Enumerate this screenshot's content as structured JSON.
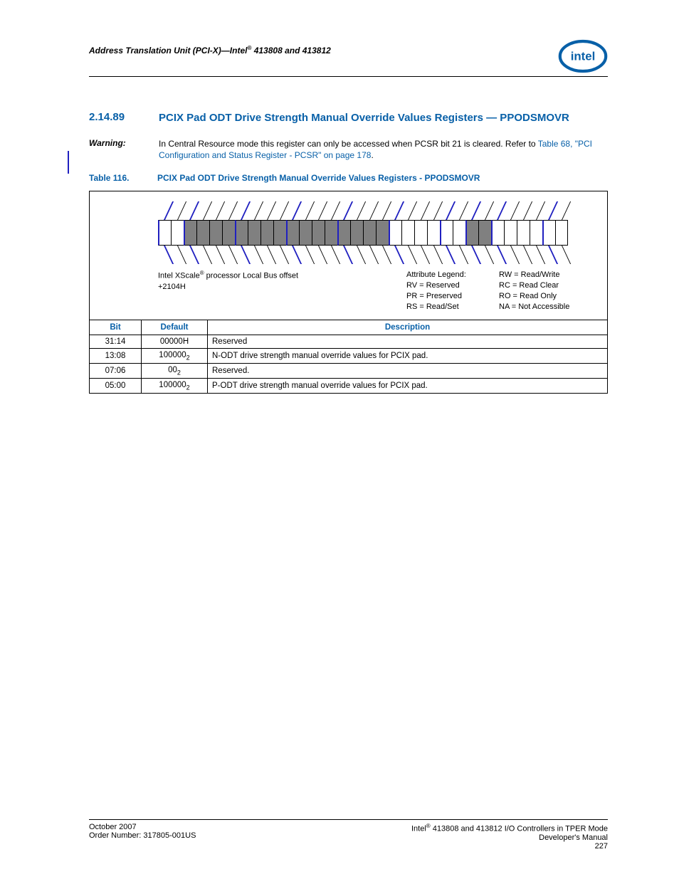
{
  "header": {
    "text_left": "Address Translation Unit (PCI-X)—Intel",
    "text_right": " 413808 and 413812",
    "logo_text": "intel"
  },
  "section": {
    "number": "2.14.89",
    "title": "PCIX Pad ODT Drive Strength Manual Override Values Registers — PPODSMOVR"
  },
  "warning": {
    "label": "Warning:",
    "text_a": "In Central Resource mode this register can only be accessed when PCSR bit 21 is cleared. Refer to ",
    "link": "Table 68, \"PCI Configuration and Status Register - PCSR\" on page 178",
    "text_b": "."
  },
  "table_caption": {
    "number": "Table 116.",
    "title": "PCIX Pad ODT Drive Strength Manual Override Values Registers - PPODSMOVR"
  },
  "diagram": {
    "bits": [
      {
        "shaded": false,
        "group_start": true
      },
      {
        "shaded": false,
        "group_start": false
      },
      {
        "shaded": true,
        "group_start": true
      },
      {
        "shaded": true,
        "group_start": false
      },
      {
        "shaded": true,
        "group_start": false
      },
      {
        "shaded": true,
        "group_start": false
      },
      {
        "shaded": true,
        "group_start": true
      },
      {
        "shaded": true,
        "group_start": false
      },
      {
        "shaded": true,
        "group_start": false
      },
      {
        "shaded": true,
        "group_start": false
      },
      {
        "shaded": true,
        "group_start": true
      },
      {
        "shaded": true,
        "group_start": false
      },
      {
        "shaded": true,
        "group_start": false
      },
      {
        "shaded": true,
        "group_start": false
      },
      {
        "shaded": true,
        "group_start": true
      },
      {
        "shaded": true,
        "group_start": false
      },
      {
        "shaded": true,
        "group_start": false
      },
      {
        "shaded": true,
        "group_start": false
      },
      {
        "shaded": false,
        "group_start": true
      },
      {
        "shaded": false,
        "group_start": false
      },
      {
        "shaded": false,
        "group_start": false
      },
      {
        "shaded": false,
        "group_start": false
      },
      {
        "shaded": false,
        "group_start": true
      },
      {
        "shaded": false,
        "group_start": false
      },
      {
        "shaded": true,
        "group_start": true
      },
      {
        "shaded": true,
        "group_start": false
      },
      {
        "shaded": false,
        "group_start": true
      },
      {
        "shaded": false,
        "group_start": false
      },
      {
        "shaded": false,
        "group_start": false
      },
      {
        "shaded": false,
        "group_start": false
      },
      {
        "shaded": false,
        "group_start": true
      },
      {
        "shaded": false,
        "group_start": false
      }
    ],
    "legend_left_line1_a": "Intel XScale",
    "legend_left_line1_b": " processor Local Bus offset",
    "legend_left_line2": "+2104H",
    "legend_mid_title": "Attribute Legend:",
    "legend_mid_rv": "RV = Reserved",
    "legend_mid_pr": "PR = Preserved",
    "legend_mid_rs": "RS = Read/Set",
    "legend_right_rw": "RW = Read/Write",
    "legend_right_rc": "RC = Read Clear",
    "legend_right_ro": "RO = Read Only",
    "legend_right_na": "NA = Not Accessible"
  },
  "table": {
    "headers": {
      "bit": "Bit",
      "default": "Default",
      "description": "Description"
    },
    "rows": [
      {
        "bit": "31:14",
        "default": "00000H",
        "default_sub": "",
        "desc": "Reserved"
      },
      {
        "bit": "13:08",
        "default": "100000",
        "default_sub": "2",
        "desc": "N-ODT drive strength manual override values for PCIX pad."
      },
      {
        "bit": "07:06",
        "default": "00",
        "default_sub": "2",
        "desc": "Reserved."
      },
      {
        "bit": "05:00",
        "default": "100000",
        "default_sub": "2",
        "desc": "P-ODT drive strength manual override values for PCIX pad."
      }
    ]
  },
  "footer": {
    "left_line1": "October 2007",
    "left_line2": "Order Number: 317805-001US",
    "right_line1_a": "Intel",
    "right_line1_b": " 413808 and 413812 I/O Controllers in TPER Mode",
    "right_line2": "Developer's Manual",
    "right_line3": "227"
  }
}
